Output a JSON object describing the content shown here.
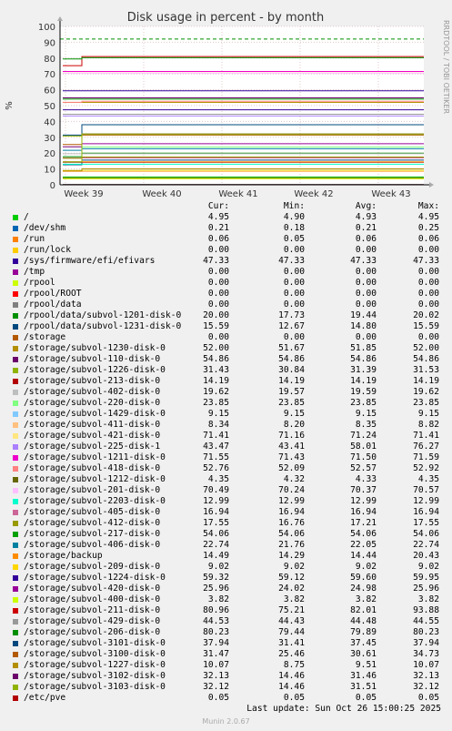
{
  "chart_data": {
    "type": "line",
    "title": "Disk usage in percent - by month",
    "ylabel": "%",
    "ylim": [
      0,
      100
    ],
    "yticks": [
      0,
      10,
      20,
      30,
      40,
      50,
      60,
      70,
      80,
      90,
      100
    ],
    "xticks": [
      "Week 39",
      "Week 40",
      "Week 41",
      "Week 42",
      "Week 43"
    ],
    "warning_line": 92,
    "grid": true,
    "side_label": "RRDTOOL / TOBI OETIKER",
    "columns": [
      "Cur:",
      "Min:",
      "Avg:",
      "Max:"
    ],
    "series": [
      {
        "name": "/",
        "color": "#00cc00",
        "cur": "4.95",
        "min": "4.90",
        "avg": "4.93",
        "max": "4.95"
      },
      {
        "name": "/dev/shm",
        "color": "#0066b3",
        "cur": "0.21",
        "min": "0.18",
        "avg": "0.21",
        "max": "0.25"
      },
      {
        "name": "/run",
        "color": "#ff8000",
        "cur": "0.06",
        "min": "0.05",
        "avg": "0.06",
        "max": "0.06"
      },
      {
        "name": "/run/lock",
        "color": "#ffcc00",
        "cur": "0.00",
        "min": "0.00",
        "avg": "0.00",
        "max": "0.00"
      },
      {
        "name": "/sys/firmware/efi/efivars",
        "color": "#330099",
        "cur": "47.33",
        "min": "47.33",
        "avg": "47.33",
        "max": "47.33"
      },
      {
        "name": "/tmp",
        "color": "#990099",
        "cur": "0.00",
        "min": "0.00",
        "avg": "0.00",
        "max": "0.00"
      },
      {
        "name": "/rpool",
        "color": "#ccff00",
        "cur": "0.00",
        "min": "0.00",
        "avg": "0.00",
        "max": "0.00"
      },
      {
        "name": "/rpool/ROOT",
        "color": "#ff0000",
        "cur": "0.00",
        "min": "0.00",
        "avg": "0.00",
        "max": "0.00"
      },
      {
        "name": "/rpool/data",
        "color": "#808080",
        "cur": "0.00",
        "min": "0.00",
        "avg": "0.00",
        "max": "0.00"
      },
      {
        "name": "/rpool/data/subvol-1201-disk-0",
        "color": "#008f00",
        "cur": "20.00",
        "min": "17.73",
        "avg": "19.44",
        "max": "20.02"
      },
      {
        "name": "/rpool/data/subvol-1231-disk-0",
        "color": "#00487d",
        "cur": "15.59",
        "min": "12.67",
        "avg": "14.80",
        "max": "15.59"
      },
      {
        "name": "/storage",
        "color": "#b35a00",
        "cur": "0.00",
        "min": "0.00",
        "avg": "0.00",
        "max": "0.00"
      },
      {
        "name": "/storage/subvol-1230-disk-0",
        "color": "#b38f00",
        "cur": "52.00",
        "min": "51.67",
        "avg": "51.85",
        "max": "52.00"
      },
      {
        "name": "/storage/subvol-110-disk-0",
        "color": "#6b006b",
        "cur": "54.86",
        "min": "54.86",
        "avg": "54.86",
        "max": "54.86"
      },
      {
        "name": "/storage/subvol-1226-disk-0",
        "color": "#8fb300",
        "cur": "31.43",
        "min": "30.84",
        "avg": "31.39",
        "max": "31.53"
      },
      {
        "name": "/storage/subvol-213-disk-0",
        "color": "#b30000",
        "cur": "14.19",
        "min": "14.19",
        "avg": "14.19",
        "max": "14.19"
      },
      {
        "name": "/storage/subvol-402-disk-0",
        "color": "#bebebe",
        "cur": "19.62",
        "min": "19.57",
        "avg": "19.59",
        "max": "19.62"
      },
      {
        "name": "/storage/subvol-220-disk-0",
        "color": "#80ff80",
        "cur": "23.85",
        "min": "23.85",
        "avg": "23.85",
        "max": "23.85"
      },
      {
        "name": "/storage/subvol-1429-disk-0",
        "color": "#80c9ff",
        "cur": "9.15",
        "min": "9.15",
        "avg": "9.15",
        "max": "9.15"
      },
      {
        "name": "/storage/subvol-411-disk-0",
        "color": "#ffc080",
        "cur": "8.34",
        "min": "8.20",
        "avg": "8.35",
        "max": "8.82"
      },
      {
        "name": "/storage/subvol-421-disk-0",
        "color": "#ffe680",
        "cur": "71.41",
        "min": "71.16",
        "avg": "71.24",
        "max": "71.41"
      },
      {
        "name": "/storage/subvol-225-disk-1",
        "color": "#aa80ff",
        "cur": "43.47",
        "min": "43.41",
        "avg": "58.01",
        "max": "76.27"
      },
      {
        "name": "/storage/subvol-1211-disk-0",
        "color": "#ee00cc",
        "cur": "71.55",
        "min": "71.43",
        "avg": "71.50",
        "max": "71.59"
      },
      {
        "name": "/storage/subvol-418-disk-0",
        "color": "#ff8080",
        "cur": "52.76",
        "min": "52.09",
        "avg": "52.57",
        "max": "52.92"
      },
      {
        "name": "/storage/subvol-1212-disk-0",
        "color": "#666600",
        "cur": "4.35",
        "min": "4.32",
        "avg": "4.33",
        "max": "4.35"
      },
      {
        "name": "/storage/subvol-201-disk-0",
        "color": "#ffbfff",
        "cur": "70.49",
        "min": "70.24",
        "avg": "70.37",
        "max": "70.57"
      },
      {
        "name": "/storage/subvol-2203-disk-0",
        "color": "#00ffcc",
        "cur": "12.99",
        "min": "12.99",
        "avg": "12.99",
        "max": "12.99"
      },
      {
        "name": "/storage/subvol-405-disk-0",
        "color": "#cc6699",
        "cur": "16.94",
        "min": "16.94",
        "avg": "16.94",
        "max": "16.94"
      },
      {
        "name": "/storage/subvol-412-disk-0",
        "color": "#999900",
        "cur": "17.55",
        "min": "16.76",
        "avg": "17.21",
        "max": "17.55"
      },
      {
        "name": "/storage/subvol-217-disk-0",
        "color": "#00a000",
        "cur": "54.06",
        "min": "54.06",
        "avg": "54.06",
        "max": "54.06"
      },
      {
        "name": "/storage/subvol-406-disk-0",
        "color": "#0080a0",
        "cur": "22.74",
        "min": "21.76",
        "avg": "22.05",
        "max": "22.74"
      },
      {
        "name": "/storage/backup",
        "color": "#ff8c00",
        "cur": "14.49",
        "min": "14.29",
        "avg": "14.44",
        "max": "20.43"
      },
      {
        "name": "/storage/subvol-209-disk-0",
        "color": "#ffd700",
        "cur": "9.02",
        "min": "9.02",
        "avg": "9.02",
        "max": "9.02"
      },
      {
        "name": "/storage/subvol-1224-disk-0",
        "color": "#330099",
        "cur": "59.32",
        "min": "59.12",
        "avg": "59.60",
        "max": "59.95"
      },
      {
        "name": "/storage/subvol-420-disk-0",
        "color": "#990099",
        "cur": "25.96",
        "min": "24.02",
        "avg": "24.98",
        "max": "25.96"
      },
      {
        "name": "/storage/subvol-400-disk-0",
        "color": "#ccff00",
        "cur": "3.82",
        "min": "3.82",
        "avg": "3.82",
        "max": "3.82"
      },
      {
        "name": "/storage/subvol-211-disk-0",
        "color": "#cc0000",
        "cur": "80.96",
        "min": "75.21",
        "avg": "82.01",
        "max": "93.88"
      },
      {
        "name": "/storage/subvol-429-disk-0",
        "color": "#999999",
        "cur": "44.53",
        "min": "44.43",
        "avg": "44.48",
        "max": "44.55"
      },
      {
        "name": "/storage/subvol-206-disk-0",
        "color": "#008f00",
        "cur": "80.23",
        "min": "79.44",
        "avg": "79.89",
        "max": "80.23"
      },
      {
        "name": "/storage/subvol-3101-disk-0",
        "color": "#00487d",
        "cur": "37.94",
        "min": "31.41",
        "avg": "37.45",
        "max": "37.94"
      },
      {
        "name": "/storage/subvol-3100-disk-0",
        "color": "#b35a00",
        "cur": "31.47",
        "min": "25.46",
        "avg": "30.61",
        "max": "34.73"
      },
      {
        "name": "/storage/subvol-1227-disk-0",
        "color": "#b38f00",
        "cur": "10.07",
        "min": "8.75",
        "avg": "9.51",
        "max": "10.07"
      },
      {
        "name": "/storage/subvol-3102-disk-0",
        "color": "#6b006b",
        "cur": "32.13",
        "min": "14.46",
        "avg": "31.46",
        "max": "32.13"
      },
      {
        "name": "/storage/subvol-3103-disk-0",
        "color": "#8fb300",
        "cur": "32.12",
        "min": "14.46",
        "avg": "31.51",
        "max": "32.12"
      },
      {
        "name": "/etc/pve",
        "color": "#b30000",
        "cur": "0.05",
        "min": "0.05",
        "avg": "0.05",
        "max": "0.05"
      }
    ]
  },
  "footer": {
    "last_update": "Last update: Sun Oct 26 15:00:25 2025",
    "munin_version": "Munin 2.0.67"
  }
}
